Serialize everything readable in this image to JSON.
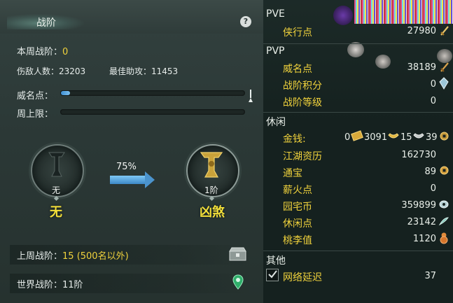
{
  "left": {
    "title": "战阶",
    "help_icon": "?",
    "weekly_rank_label": "本周战阶：",
    "weekly_rank_value": "0",
    "enemies_label": "伤敌人数：",
    "enemies_value": "23203",
    "assists_label": "最佳助攻：",
    "assists_value": "11453",
    "prestige_label": "威名点：",
    "prestige_progress": 0.05,
    "weekly_cap_label": "周上限：",
    "weekly_cap_progress": 0.0,
    "current_rank_small": "无",
    "current_rank_big": "无",
    "progress_percent": "75%",
    "next_rank_small": "1阶",
    "next_rank_big": "凶煞",
    "last_week_label": "上周战阶：",
    "last_week_value": "15 (500名以外)",
    "world_label": "世界战阶：",
    "world_value": "11阶"
  },
  "right": {
    "pve_header": "PVE",
    "pvp_header": "PVP",
    "leisure_header": "休闲",
    "other_header": "其他",
    "pve": [
      {
        "label": "侠行点",
        "value": "27980"
      }
    ],
    "pvp": [
      {
        "label": "威名点",
        "value": "38189"
      },
      {
        "label": "战阶积分",
        "value": "0"
      },
      {
        "label": "战阶等级",
        "value": "0"
      }
    ],
    "money": {
      "label": "金钱:",
      "gold": "0",
      "silver": "3091",
      "copper": "15",
      "tael": "39"
    },
    "leisure": [
      {
        "label": "江湖资历",
        "value": "162730"
      },
      {
        "label": "通宝",
        "value": "89"
      },
      {
        "label": "薪火点",
        "value": "0"
      },
      {
        "label": "园宅币",
        "value": "359899"
      },
      {
        "label": "休闲点",
        "value": "23142"
      },
      {
        "label": "桃李值",
        "value": "1120"
      }
    ],
    "network": {
      "label": "网络延迟",
      "value": "37",
      "checked": true
    }
  },
  "colors": {
    "accent_yellow": "#f0d23c",
    "progress_blue": "#4a9be0",
    "panel_bg": "#2b3836"
  }
}
